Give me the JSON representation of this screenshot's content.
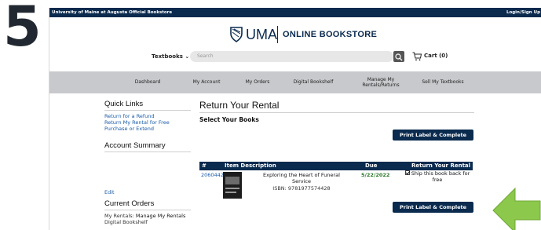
{
  "step": "5",
  "topbar": {
    "site_name": "University of Maine at Augusta Official Bookstore",
    "login": "Login/Sign Up"
  },
  "logo": {
    "brand": "UMA",
    "store": "ONLINE BOOKSTORE"
  },
  "search": {
    "category": "Textbooks",
    "placeholder": "Search",
    "cart_label": "Cart (0)"
  },
  "nav": {
    "items": [
      "Dashboard",
      "My Account",
      "My Orders",
      "Digital Bookshelf",
      "Manage My Rentals/Returns",
      "Sell My Textbooks"
    ]
  },
  "sidebar": {
    "quick_links_title": "Quick Links",
    "links": [
      "Return for a Refund",
      "Return My Rental for Free",
      "Purchase or Extend"
    ],
    "account_summary_title": "Account Summary",
    "edit_label": "Edit",
    "current_orders_title": "Current Orders",
    "my_rentals_label": "My Rentals:",
    "manage_rentals_label": "Manage My Rentals",
    "digital_bookshelf_label": "Digital Bookshelf"
  },
  "main": {
    "title": "Return Your Rental",
    "subtitle": "Select Your Books",
    "print_button": "Print Label & Complete Return",
    "print_button_bottom": "Print Label & Complete Return"
  },
  "table": {
    "headers": [
      "#",
      "Item Description",
      "Due",
      "Return Your Rental"
    ],
    "rows": [
      {
        "number": "2060442",
        "title": "Exploring the Heart of Funeral Service",
        "isbn": "ISBN: 9781977574428",
        "due": "5/22/2022",
        "ship_label": "Ship this book back for free"
      }
    ]
  },
  "colors": {
    "navy": "#0a2a4e",
    "link": "#1a5aa6",
    "due_green": "#2a7a2a",
    "arrow": "#8cc84b",
    "nav_gray": "#c7c9cc"
  }
}
